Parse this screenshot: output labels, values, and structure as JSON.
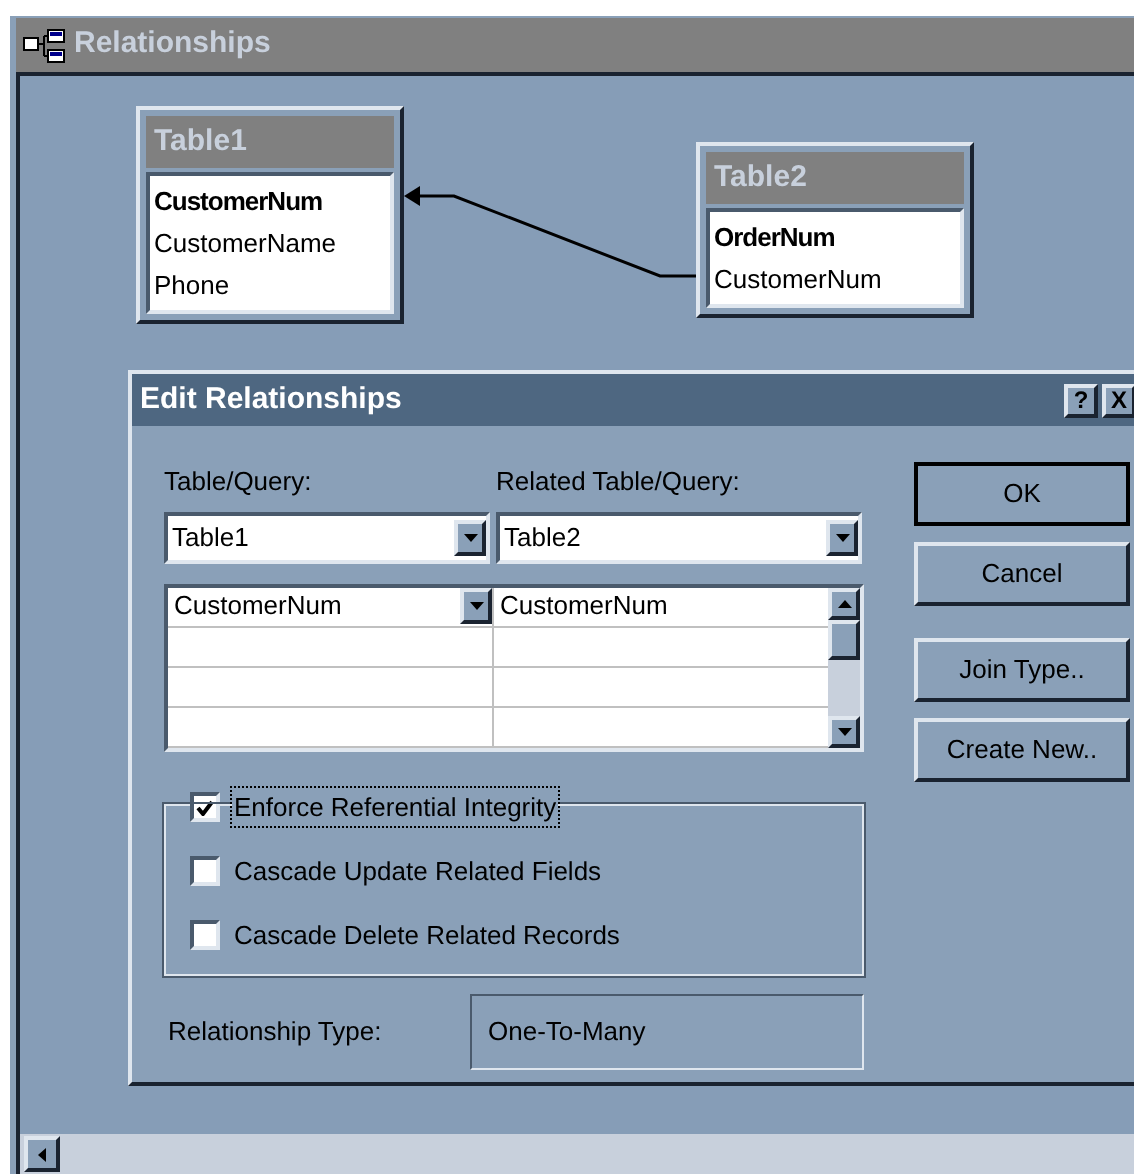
{
  "window": {
    "title": "Relationships"
  },
  "tables": [
    {
      "title": "Table1",
      "fields": [
        {
          "name": "CustomerNum",
          "key": true
        },
        {
          "name": "CustomerName",
          "key": false
        },
        {
          "name": "Phone",
          "key": false
        }
      ]
    },
    {
      "title": "Table2",
      "fields": [
        {
          "name": "OrderNum",
          "key": true
        },
        {
          "name": "CustomerNum",
          "key": false
        }
      ]
    }
  ],
  "dialog": {
    "title": "Edit Relationships",
    "help_button": "?",
    "close_button": "X",
    "table_label": {
      "label": "Table/Query:"
    },
    "table_value": "Table1",
    "related_label": {
      "label": "Related Table/Query:"
    },
    "related_value": "Table2",
    "field_rows": [
      {
        "field": "CustomerNum",
        "related_field": "CustomerNum"
      }
    ],
    "options": [
      {
        "label": "Enforce Referential Integrity",
        "checked": true,
        "focused": true
      },
      {
        "label": "Cascade Update Related Fields",
        "checked": false,
        "focused": false
      },
      {
        "label": "Cascade Delete Related Records",
        "checked": false,
        "focused": false
      }
    ],
    "relationship_type": {
      "label": "Relationship Type:",
      "value": "One-To-Many"
    },
    "buttons": [
      {
        "label": "OK",
        "default": true
      },
      {
        "label": "Cancel",
        "default": false
      },
      {
        "label": "Join Type..",
        "default": false
      },
      {
        "label": "Create New..",
        "default": false
      }
    ]
  }
}
